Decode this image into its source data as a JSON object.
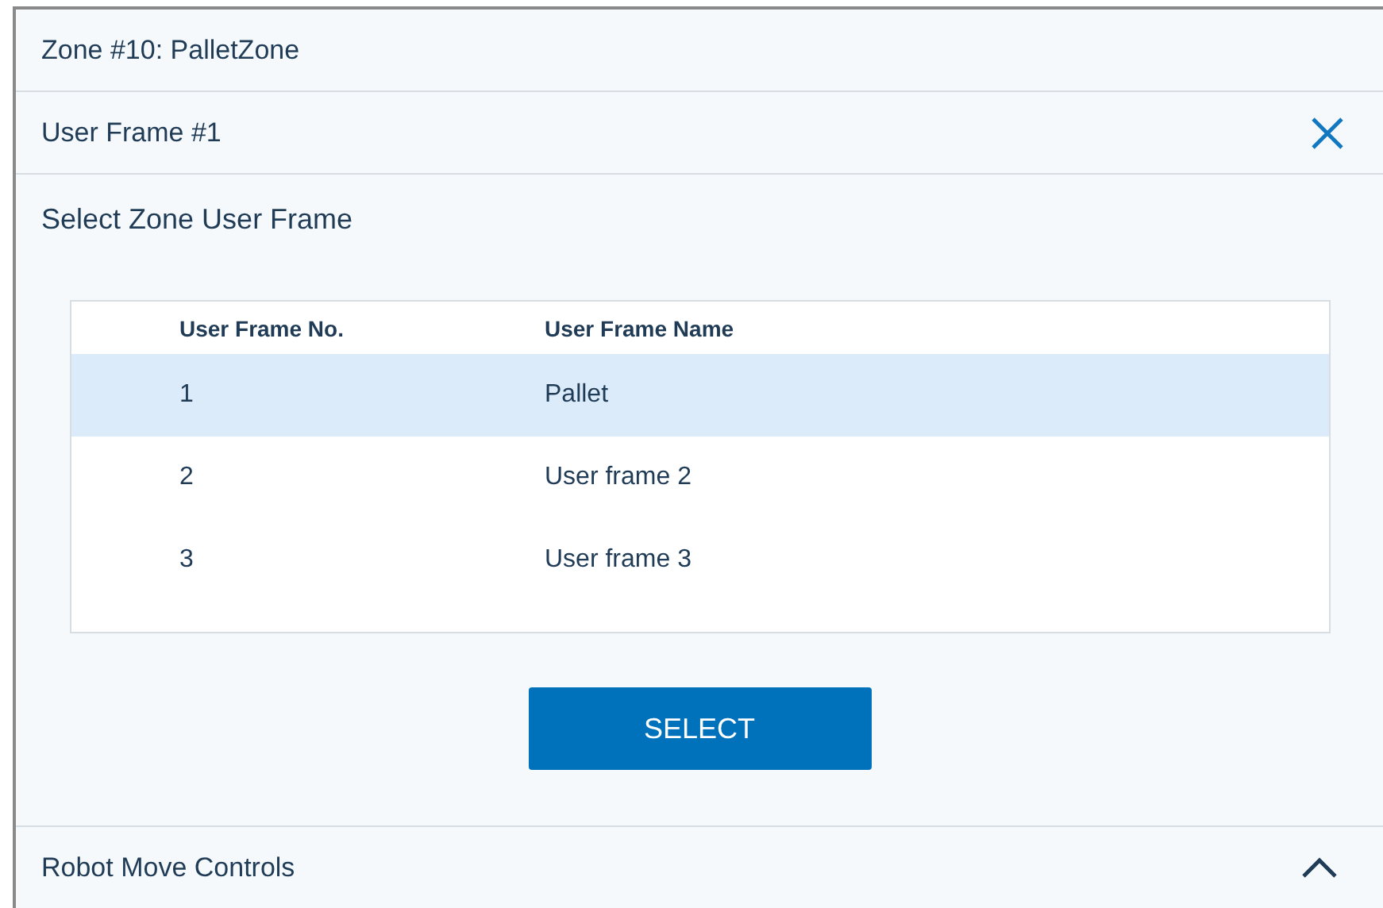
{
  "zone_header": {
    "title": "Zone #10: PalletZone"
  },
  "section": {
    "title": "User Frame #1"
  },
  "prompt": "Select Zone User Frame",
  "table": {
    "columns": [
      "User Frame No.",
      "User Frame Name"
    ],
    "rows": [
      {
        "number": "1",
        "name": "Pallet",
        "selected": true
      },
      {
        "number": "2",
        "name": "User frame 2",
        "selected": false
      },
      {
        "number": "3",
        "name": "User frame 3",
        "selected": false
      }
    ]
  },
  "select_button": "SELECT",
  "footer_panel": {
    "title": "Robot Move Controls",
    "expanded": false
  }
}
